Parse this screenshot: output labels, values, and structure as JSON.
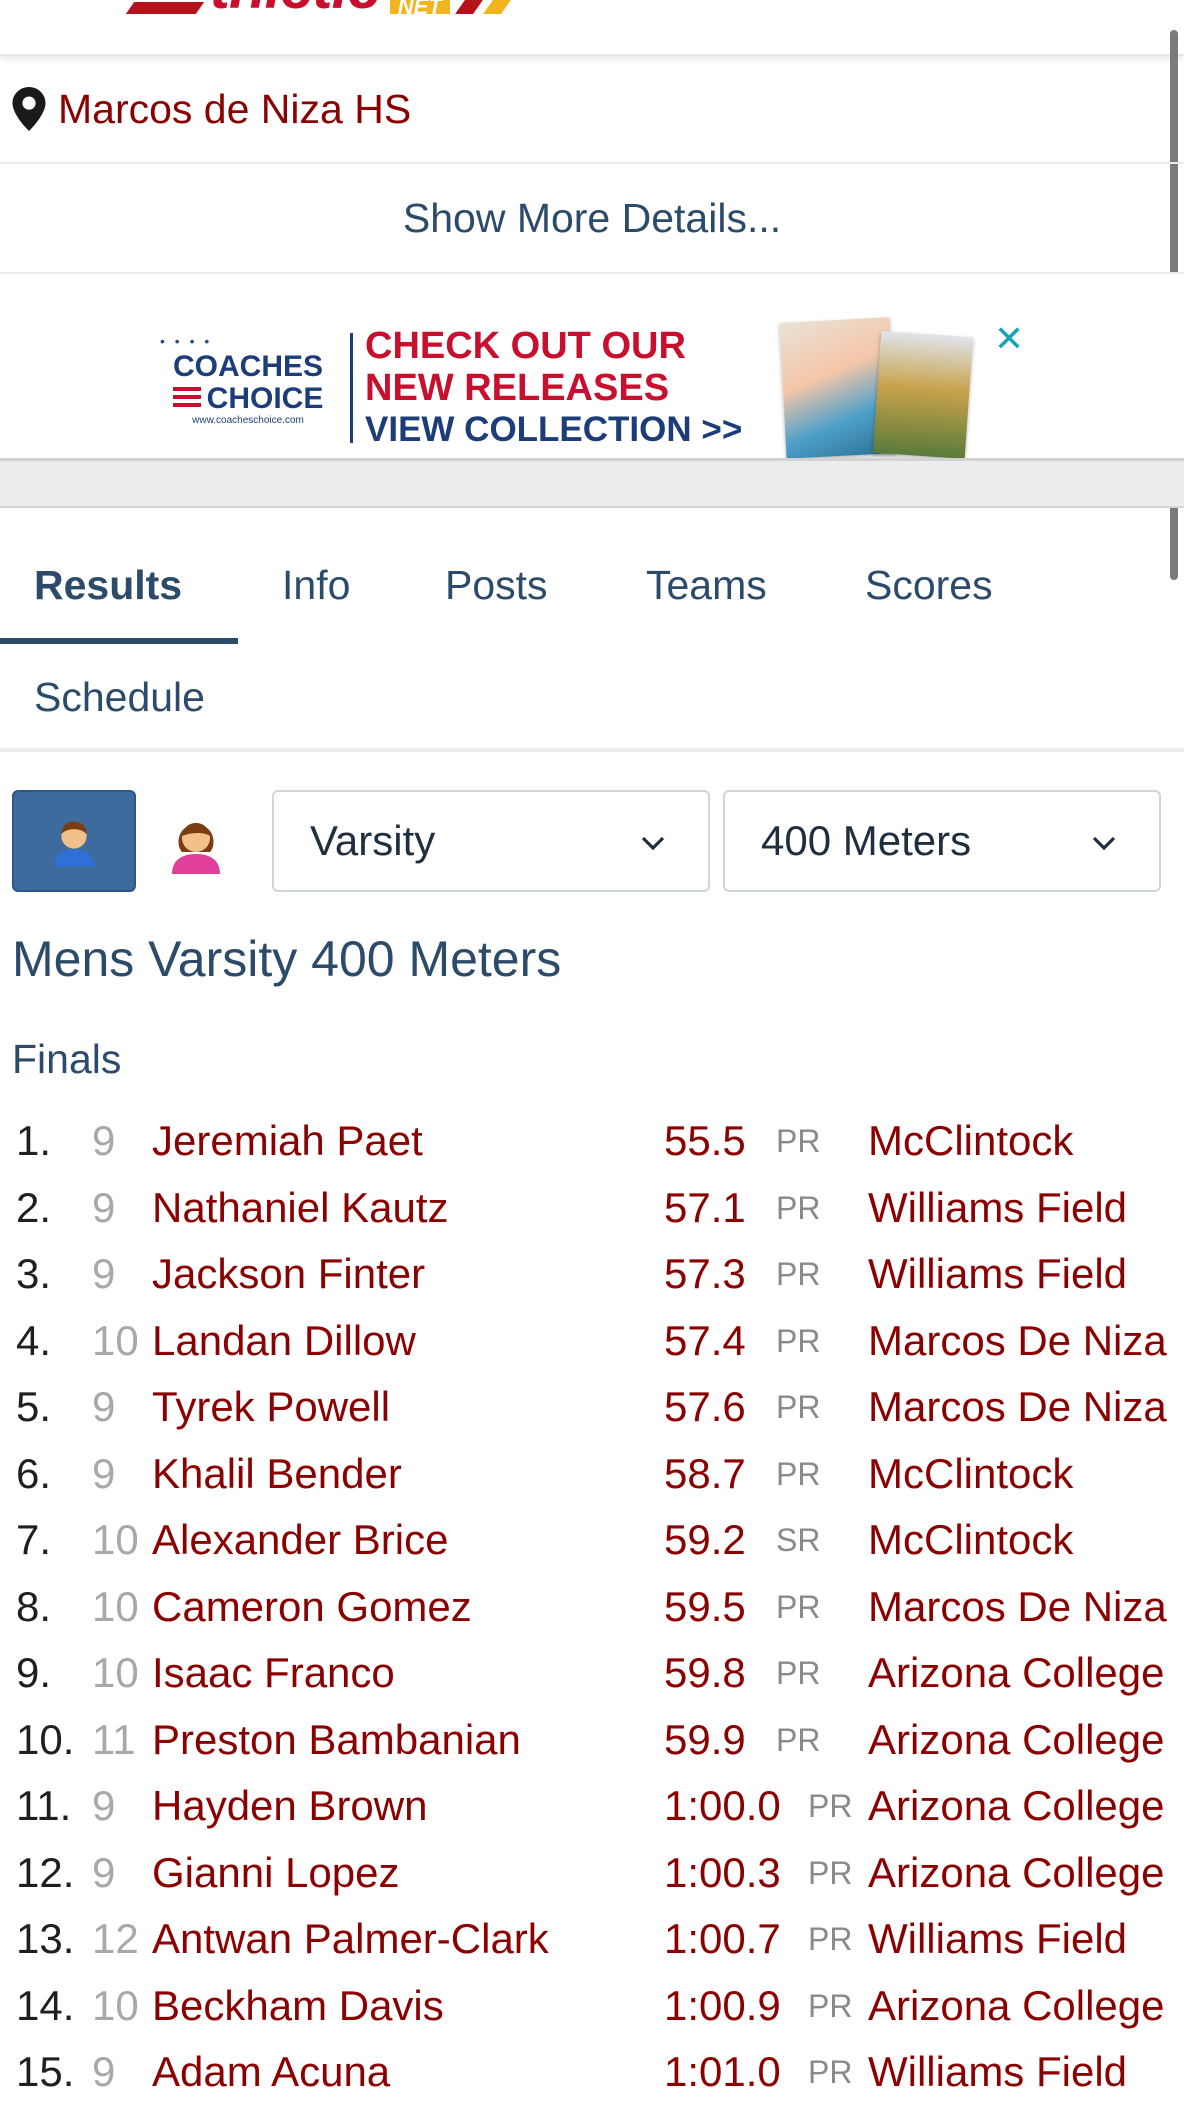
{
  "location": {
    "name": "Marcos de Niza HS"
  },
  "details": {
    "link_text": "Show More Details..."
  },
  "ad": {
    "logo_line1": "COACHES",
    "logo_line2": "CHOICE",
    "logo_site": "www.coacheschoice.com",
    "headline_1": "CHECK OUT OUR",
    "headline_2": "NEW RELEASES",
    "cta": "VIEW COLLECTION >>",
    "close_symbol": "✕"
  },
  "tabs": [
    {
      "label": "Results",
      "active": true
    },
    {
      "label": "Info"
    },
    {
      "label": "Posts"
    },
    {
      "label": "Teams"
    },
    {
      "label": "Scores"
    },
    {
      "label": "Schedule"
    }
  ],
  "filters": {
    "level": "Varsity",
    "event": "400 Meters"
  },
  "event_title": "Mens Varsity 400 Meters",
  "round": "Finals",
  "colors": {
    "accent_blue": "#3d6b9e",
    "link_red": "#8b0000",
    "text_blue": "#2c4b6b"
  },
  "results": [
    {
      "place": "1.",
      "grade": "9",
      "name": "Jeremiah Paet",
      "mark": "55.5",
      "tag": "PR",
      "team": "McClintock"
    },
    {
      "place": "2.",
      "grade": "9",
      "name": "Nathaniel Kautz",
      "mark": "57.1",
      "tag": "PR",
      "team": "Williams Field"
    },
    {
      "place": "3.",
      "grade": "9",
      "name": "Jackson Finter",
      "mark": "57.3",
      "tag": "PR",
      "team": "Williams Field"
    },
    {
      "place": "4.",
      "grade": "10",
      "name": "Landan Dillow",
      "mark": "57.4",
      "tag": "PR",
      "team": "Marcos De Niza"
    },
    {
      "place": "5.",
      "grade": "9",
      "name": "Tyrek Powell",
      "mark": "57.6",
      "tag": "PR",
      "team": "Marcos De Niza"
    },
    {
      "place": "6.",
      "grade": "9",
      "name": "Khalil Bender",
      "mark": "58.7",
      "tag": "PR",
      "team": "McClintock"
    },
    {
      "place": "7.",
      "grade": "10",
      "name": "Alexander Brice",
      "mark": "59.2",
      "tag": "SR",
      "team": "McClintock"
    },
    {
      "place": "8.",
      "grade": "10",
      "name": "Cameron Gomez",
      "mark": "59.5",
      "tag": "PR",
      "team": "Marcos De Niza"
    },
    {
      "place": "9.",
      "grade": "10",
      "name": "Isaac Franco",
      "mark": "59.8",
      "tag": "PR",
      "team": "Arizona College"
    },
    {
      "place": "10.",
      "grade": "11",
      "name": "Preston Bambanian",
      "mark": "59.9",
      "tag": "PR",
      "team": "Arizona College"
    },
    {
      "place": "11.",
      "grade": "9",
      "name": "Hayden Brown",
      "mark": "1:00.0",
      "tag": "PR",
      "team": "Arizona College"
    },
    {
      "place": "12.",
      "grade": "9",
      "name": "Gianni Lopez",
      "mark": "1:00.3",
      "tag": "PR",
      "team": "Arizona College"
    },
    {
      "place": "13.",
      "grade": "12",
      "name": "Antwan Palmer-Clark",
      "mark": "1:00.7",
      "tag": "PR",
      "team": "Williams Field"
    },
    {
      "place": "14.",
      "grade": "10",
      "name": "Beckham Davis",
      "mark": "1:00.9",
      "tag": "PR",
      "team": "Arizona College"
    },
    {
      "place": "15.",
      "grade": "9",
      "name": "Adam Acuna",
      "mark": "1:01.0",
      "tag": "PR",
      "team": "Williams Field"
    }
  ]
}
